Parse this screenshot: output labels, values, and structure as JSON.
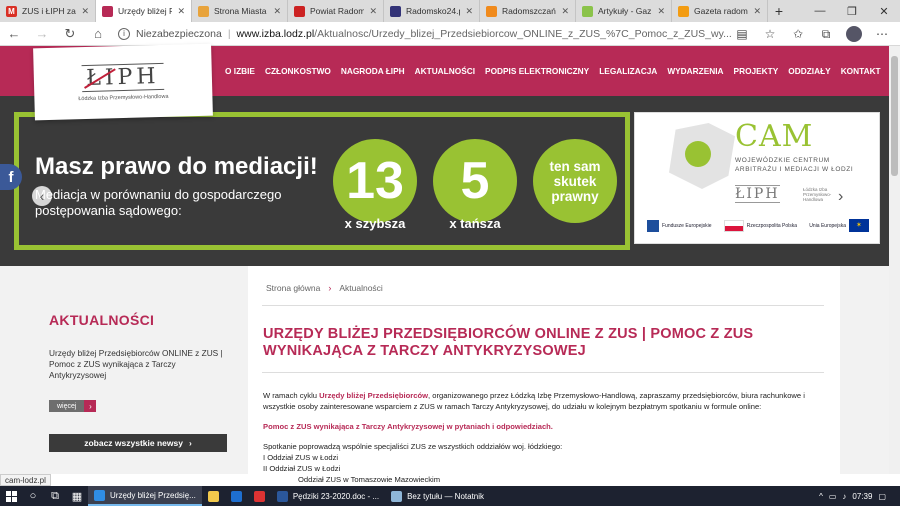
{
  "browser": {
    "tabs": [
      {
        "title": "ZUS i ŁIPH zap",
        "favicon": "M",
        "color": "#d93025",
        "active": false
      },
      {
        "title": "Urzędy bliżej P",
        "favicon": "",
        "color": "#b72a56",
        "active": true
      },
      {
        "title": "Strona Miasta",
        "favicon": "",
        "color": "#e8a33b",
        "active": false
      },
      {
        "title": "Powiat Radom",
        "favicon": "",
        "color": "#c22",
        "active": false
      },
      {
        "title": "Radomsko24.p",
        "favicon": "",
        "color": "#337",
        "active": false
      },
      {
        "title": "Radomszczań",
        "favicon": "",
        "color": "#f08a1c",
        "active": false
      },
      {
        "title": "Artykuły - Gaz",
        "favicon": "",
        "color": "#8bc34a",
        "active": false
      },
      {
        "title": "Gazeta radom",
        "favicon": "",
        "color": "#f39c12",
        "active": false
      }
    ],
    "security_label": "Niezabezpieczona",
    "url_host": "www.izba.lodz.pl",
    "url_path": "/Aktualnosc/Urzedy_blizej_Przedsiebiorcow_ONLINE_z_ZUS_%7C_Pomoc_z_ZUS_wy..."
  },
  "site": {
    "logo_mark": "ŁIPH",
    "logo_sub": "Łódzka Izba Przemysłowo-Handlowa",
    "nav": [
      "O IZBIE",
      "CZŁONKOSTWO",
      "NAGRODA ŁIPH",
      "AKTUALNOŚCI",
      "PODPIS ELEKTRONICZNY",
      "LEGALIZACJA",
      "WYDARZENIA",
      "PROJEKTY",
      "ODDZIAŁY",
      "KONTAKT"
    ]
  },
  "hero": {
    "title": "Masz prawo do mediacji!",
    "subtitle": "Mediacja w porównaniu do gospodarczego postępowania sądowego:",
    "circles": [
      {
        "value": "13",
        "caption": "x szybsza"
      },
      {
        "value": "5",
        "caption": "x tańsza"
      },
      {
        "value": "ten sam skutek prawny",
        "caption": ""
      }
    ],
    "cam": {
      "title": "CAM",
      "line1": "WOJEWÓDZKIE CENTRUM",
      "line2": "ARBITRAŻU I MEDIACJI W ŁODZI",
      "partner_logo": "ŁIPH",
      "partner_sub": "Łódzka Izba Przemysłowo-Handlowa",
      "eu1": "Fundusze Europejskie",
      "eu2": "Rzeczpospolita Polska",
      "eu3": "Unia Europejska"
    }
  },
  "breadcrumb": {
    "home": "Strona główna",
    "current": "Aktualności"
  },
  "sidebar": {
    "title": "AKTUALNOŚCI",
    "news_item": "Urzędy bliżej Przedsiębiorców ONLINE z ZUS | Pomoc z ZUS wynikająca z Tarczy Antykryzysowej",
    "more_label": "więcej",
    "all_news_label": "zobacz wszystkie newsy"
  },
  "article": {
    "title": "URZĘDY BLIŻEJ PRZEDSIĘBIORCÓW ONLINE Z ZUS | POMOC Z ZUS WYNIKAJĄCA Z TARCZY ANTYKRYZYSOWEJ",
    "intro_prefix": "W ramach cyklu ",
    "intro_highlight": "Urzędy bliżej Przedsiębiorców",
    "intro_rest": ", organizowanego przez Łódzką Izbę Przemysłowo-Handlową, zapraszamy przedsiębiorców, biura rachunkowe i wszystkie osoby zainteresowane wsparciem z ZUS w ramach Tarczy Antykryzysowej, do udziału w kolejnym bezpłatnym spotkaniu w formule online:",
    "headline": "Pomoc z ZUS wynikająca z Tarczy Antykryzysowej w pytaniach i odpowiedziach.",
    "specialists": "Spotkanie poprowadzą wspólnie specjaliści ZUS ze wszystkich oddziałów woj. łódzkiego:",
    "branch1": "I Oddział ZUS w Łodzi",
    "branch2": "II Oddział ZUS w Łodzi",
    "branch3": "Oddział ZUS w Tomaszowie Mazowieckim"
  },
  "status_url": "cam-lodz.pl",
  "taskbar": {
    "apps": [
      {
        "label": "Urzędy bliżej Przedsię...",
        "color": "#2f8de4",
        "active": true
      },
      {
        "label": "",
        "color": "#f2c94c",
        "active": false
      },
      {
        "label": "",
        "color": "#1e6fd0",
        "active": false
      },
      {
        "label": "",
        "color": "#d33",
        "active": false
      },
      {
        "label": "Pędziki 23-2020.doc - ...",
        "color": "#2b579a",
        "active": false
      },
      {
        "label": "Bez tytułu — Notatnik",
        "color": "#8fb6d8",
        "active": false
      }
    ],
    "time": "07:39"
  }
}
